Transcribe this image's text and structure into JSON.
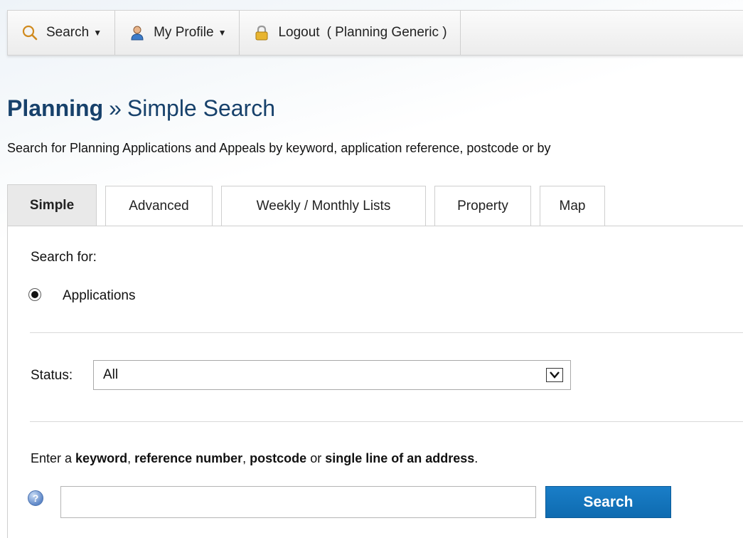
{
  "nav": {
    "search": {
      "label": "Search",
      "icon": "search-icon",
      "has_caret": true
    },
    "profile": {
      "label": "My Profile",
      "icon": "user-icon",
      "has_caret": true
    },
    "logout": {
      "label": "Logout",
      "user": "( Planning Generic )",
      "icon": "lock-icon"
    }
  },
  "header": {
    "crumb": "Planning",
    "separator": "»",
    "title": "Simple Search"
  },
  "intro_text": "Search for Planning Applications and Appeals by keyword, application reference, postcode or by",
  "tabs": [
    {
      "label": "Simple",
      "active": true
    },
    {
      "label": "Advanced",
      "active": false
    },
    {
      "label": "Weekly / Monthly Lists",
      "active": false
    },
    {
      "label": "Property",
      "active": false
    },
    {
      "label": "Map",
      "active": false
    }
  ],
  "form": {
    "search_for_label": "Search for:",
    "search_for_option": "Applications",
    "search_for_selected": true,
    "status_label": "Status:",
    "status_value": "All",
    "instructions": {
      "p1": "Enter a ",
      "b1": "keyword",
      "p2": ", ",
      "b2": "reference number",
      "p3": ", ",
      "b3": "postcode",
      "p4": " or ",
      "b4": "single line of an address",
      "p5": "."
    },
    "query_value": "",
    "query_placeholder": "",
    "help_icon": "help-icon",
    "search_button": "Search"
  },
  "colors": {
    "title": "#17416b",
    "button": "#1175bd",
    "active_tab": "#e9e9e9"
  }
}
